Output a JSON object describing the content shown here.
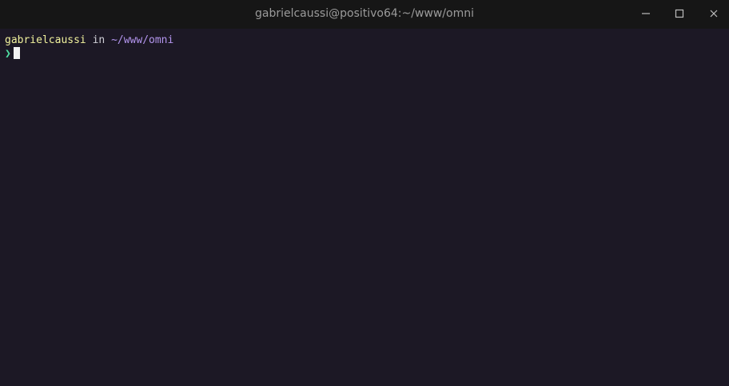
{
  "window": {
    "title": "gabrielcaussi@positivo64:~/www/omni",
    "controls": {
      "minimize_icon": "minimize-icon",
      "maximize_icon": "maximize-icon",
      "close_icon": "close-icon"
    }
  },
  "terminal": {
    "prompt": {
      "user": "gabrielcaussi",
      "separator": " in ",
      "path": "~/www/omni",
      "symbol": "❯"
    },
    "input": "",
    "colors": {
      "background": "#1c1825",
      "user": "#f1f29d",
      "path": "#b395ee",
      "prompt_symbol": "#4ee0a3",
      "cursor": "#f2f2f2"
    }
  }
}
